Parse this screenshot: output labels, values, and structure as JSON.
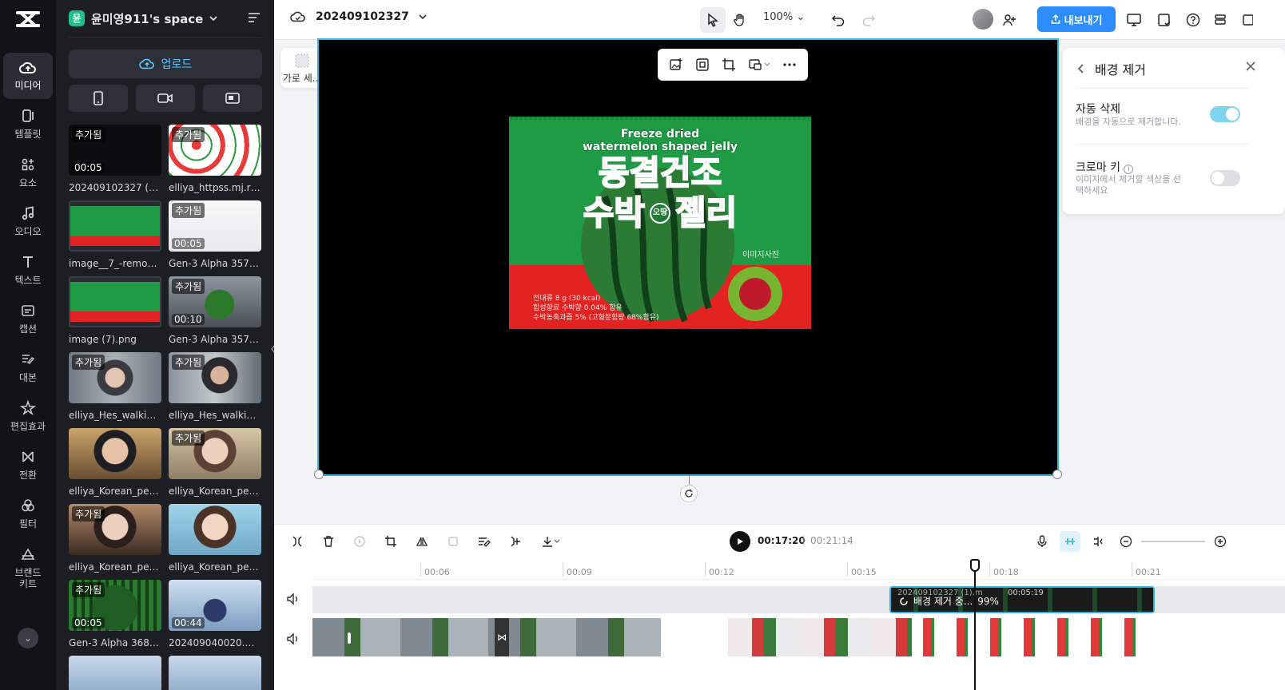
{
  "nav": {
    "items": [
      {
        "label": "미디어",
        "icon": "cloud-upload-icon",
        "active": true
      },
      {
        "label": "템플릿",
        "icon": "template-icon"
      },
      {
        "label": "요소",
        "icon": "elements-icon"
      },
      {
        "label": "오디오",
        "icon": "music-note-icon"
      },
      {
        "label": "텍스트",
        "icon": "text-icon"
      },
      {
        "label": "캡션",
        "icon": "caption-icon"
      },
      {
        "label": "대본",
        "icon": "script-icon"
      },
      {
        "label": "편집효과",
        "icon": "effects-icon"
      },
      {
        "label": "전환",
        "icon": "transition-icon"
      },
      {
        "label": "필터",
        "icon": "filter-icon"
      },
      {
        "label": "브랜드\n키트",
        "icon": "brand-kit-icon"
      }
    ]
  },
  "media": {
    "workspace_badge": "윤",
    "workspace": "윤미영911's space",
    "upload_label": "업로드",
    "items": [
      {
        "name": "202409102327 (1)...",
        "tag": "추가됨",
        "duration": "00:05",
        "style": "dark"
      },
      {
        "name": "elliya_httpss.mj.run...",
        "tag": "추가됨",
        "duration": "",
        "style": "watermelon-slices"
      },
      {
        "name": "image__7_-remove...",
        "tag": "",
        "duration": "",
        "style": "jelly-pack"
      },
      {
        "name": "Gen-3 Alpha 3576...",
        "tag": "추가됨",
        "duration": "00:05",
        "style": "white"
      },
      {
        "name": "image (7).png",
        "tag": "",
        "duration": "",
        "style": "jelly-pack"
      },
      {
        "name": "Gen-3 Alpha 3576...",
        "tag": "추가됨",
        "duration": "00:10",
        "style": "city-melon"
      },
      {
        "name": "elliya_Hes_walking...",
        "tag": "추가됨",
        "duration": "",
        "style": "street-woman"
      },
      {
        "name": "elliya_Hes_walking...",
        "tag": "추가됨",
        "duration": "",
        "style": "street-man"
      },
      {
        "name": "elliya_Korean_peop...",
        "tag": "",
        "duration": "",
        "style": "surprised-man"
      },
      {
        "name": "elliya_Korean_peop...",
        "tag": "추가됨",
        "duration": "",
        "style": "surprised-woman"
      },
      {
        "name": "elliya_Korean_peop...",
        "tag": "추가됨",
        "duration": "",
        "style": "surprised-woman2"
      },
      {
        "name": "elliya_Korean_peop...",
        "tag": "",
        "duration": "",
        "style": "surprised-woman3"
      },
      {
        "name": "Gen-3 Alpha 3685...",
        "tag": "추가됨",
        "duration": "00:05",
        "style": "melon-closeup"
      },
      {
        "name": "202409040020.m...",
        "tag": "",
        "duration": "00:44",
        "style": "mall-back"
      }
    ]
  },
  "topbar": {
    "project_name": "202409102327",
    "zoom": "100%",
    "export_label": "내보내기"
  },
  "canvas": {
    "aspect_label": "가로 세..."
  },
  "product": {
    "line1": "Freeze dried",
    "line2": "watermelon shaped jelly",
    "title1": "동결건조",
    "title2a": "수박",
    "title2b": "젤리",
    "badge": "오땅",
    "brand": "이미지사진",
    "info1": "전대류 8 g (30 kcal)",
    "info2": "합성향료 수박향 0.04% 함유",
    "info3": "수박농축과즙 5% (고형분함량 68%함유)"
  },
  "bg_panel": {
    "title": "배경 제거",
    "auto_title": "자동 삭제",
    "auto_desc": "배경을 자동으로 제거합니다.",
    "auto_on": true,
    "chroma_title": "크로마 키",
    "chroma_desc": "이미지에서 제거할 색상을 선택하세요",
    "chroma_on": false
  },
  "player": {
    "current": "00:17:20",
    "separator": "|",
    "total": "00:21:14"
  },
  "timeline": {
    "ticks": [
      "00:06",
      "00:09",
      "00:12",
      "00:15",
      "00:18",
      "00:21"
    ],
    "bg_clip_label": "배경 제거 중...",
    "bg_clip_percent": "99%",
    "bg_clip_under": "202409102327 (1).m",
    "bg_clip_time": "00:05:19"
  },
  "colors": {
    "accent": "#2fb6e0",
    "export": "#2e8dfc",
    "jelly_green": "#1f9a45",
    "jelly_red": "#e32322"
  }
}
